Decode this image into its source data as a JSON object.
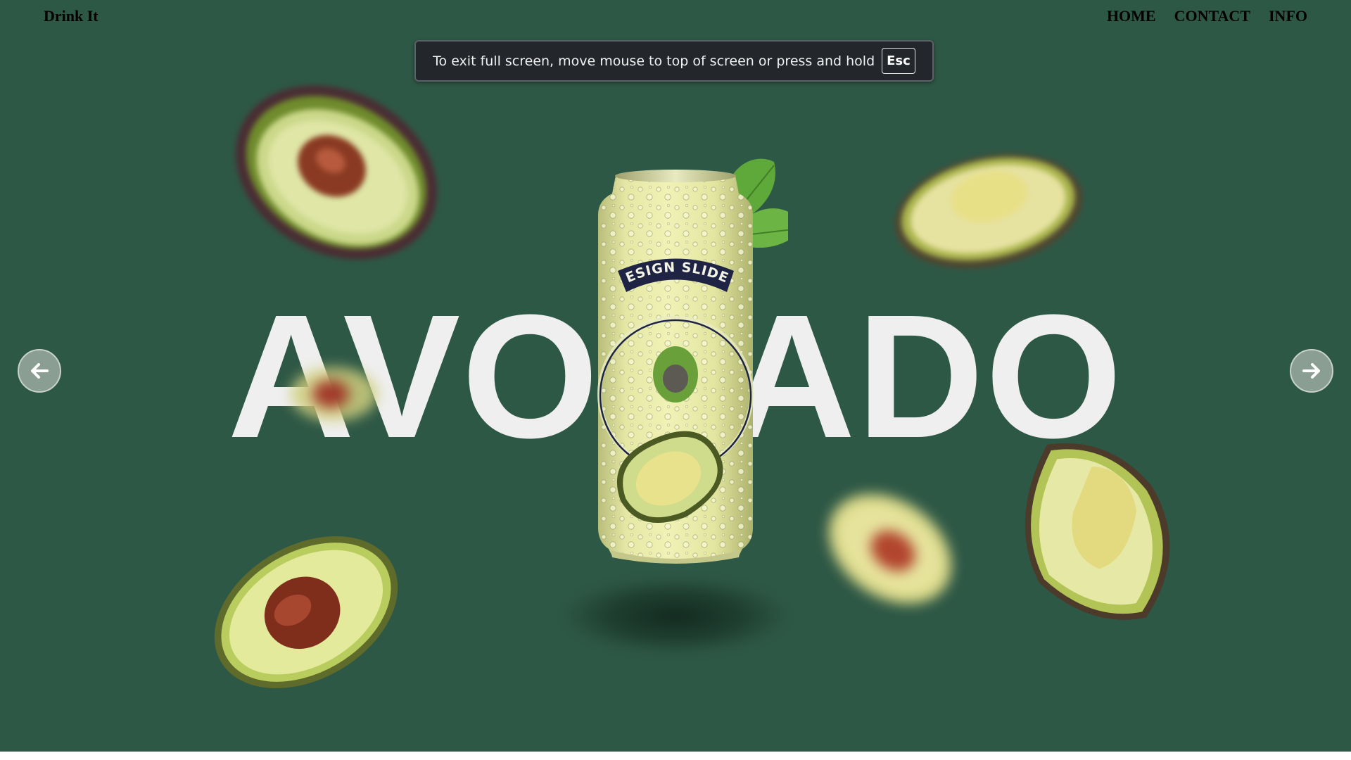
{
  "header": {
    "brand": "Drink It",
    "nav": [
      "HOME",
      "CONTACT",
      "INFO"
    ]
  },
  "fullscreen_toast": {
    "message": "To exit full screen, move mouse to top of screen or press and hold",
    "key": "Esc"
  },
  "slide": {
    "title": "AVOCADO",
    "can_label": "DESIGN SLIDER"
  },
  "controls": {
    "prev_icon": "arrow-left-icon",
    "next_icon": "arrow-right-icon"
  },
  "colors": {
    "background": "#2e5846",
    "title_text": "#efefef",
    "can_body": "#dfe4a6",
    "ribbon": "#1f2344"
  }
}
